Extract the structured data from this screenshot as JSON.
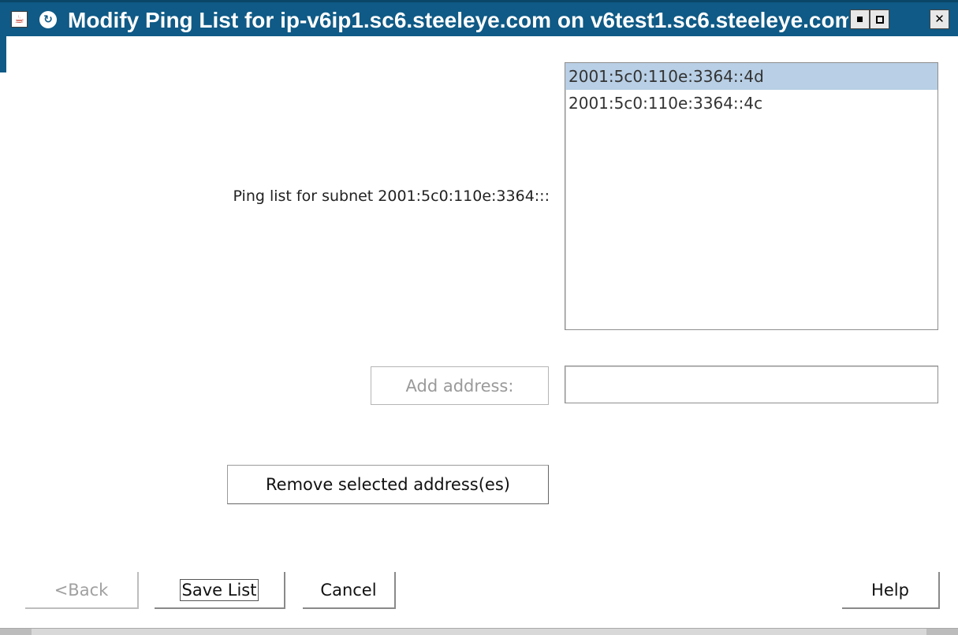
{
  "window": {
    "title": "Modify Ping List for ip-v6ip1.sc6.steeleye.com on v6test1.sc6.steeleye.com",
    "app_icon": "java-cup-icon",
    "secondary_icon": "lifekeeper-icon",
    "controls": {
      "minimize": "minimize-icon",
      "maximize": "maximize-icon",
      "close": "✕"
    }
  },
  "form": {
    "ping_label": "Ping list for subnet 2001:5c0:110e:3364:::",
    "ping_list": [
      {
        "address": "2001:5c0:110e:3364::4d",
        "selected": true
      },
      {
        "address": "2001:5c0:110e:3364::4c",
        "selected": false
      }
    ],
    "add_button_label": "Add address:",
    "add_input_value": "",
    "remove_button_label": "Remove selected address(es)"
  },
  "footer": {
    "back_label": "<Back",
    "save_label": "Save List",
    "cancel_label": "Cancel",
    "help_label": "Help"
  },
  "colors": {
    "titlebar": "#0f5a86",
    "selection": "#b8cfe5"
  }
}
